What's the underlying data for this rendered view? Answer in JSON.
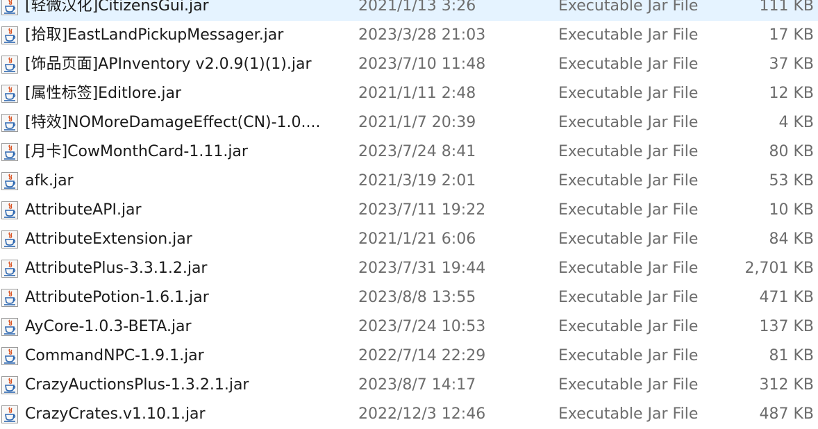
{
  "file_type_icon": "java-jar-icon",
  "files": [
    {
      "name": "[轻微汉化]CitizensGui.jar",
      "date": "2021/1/13 3:26",
      "type": "Executable Jar File",
      "size": "111 KB"
    },
    {
      "name": "[拾取]EastLandPickupMessager.jar",
      "date": "2023/3/28 21:03",
      "type": "Executable Jar File",
      "size": "17 KB"
    },
    {
      "name": "[饰品页面]APInventory v2.0.9(1)(1).jar",
      "date": "2023/7/10 11:48",
      "type": "Executable Jar File",
      "size": "37 KB"
    },
    {
      "name": "[属性标签]Editlore.jar",
      "date": "2021/1/11 2:48",
      "type": "Executable Jar File",
      "size": "12 KB"
    },
    {
      "name": "[特效]NOMoreDamageEffect(CN)-1.0....",
      "date": "2021/1/7 20:39",
      "type": "Executable Jar File",
      "size": "4 KB"
    },
    {
      "name": "[月卡]CowMonthCard-1.11.jar",
      "date": "2023/7/24 8:41",
      "type": "Executable Jar File",
      "size": "80 KB"
    },
    {
      "name": "afk.jar",
      "date": "2021/3/19 2:01",
      "type": "Executable Jar File",
      "size": "53 KB"
    },
    {
      "name": "AttributeAPI.jar",
      "date": "2023/7/11 19:22",
      "type": "Executable Jar File",
      "size": "10 KB"
    },
    {
      "name": "AttributeExtension.jar",
      "date": "2021/1/21 6:06",
      "type": "Executable Jar File",
      "size": "84 KB"
    },
    {
      "name": "AttributePlus-3.3.1.2.jar",
      "date": "2023/7/31 19:44",
      "type": "Executable Jar File",
      "size": "2,701 KB"
    },
    {
      "name": "AttributePotion-1.6.1.jar",
      "date": "2023/8/8 13:55",
      "type": "Executable Jar File",
      "size": "471 KB"
    },
    {
      "name": "AyCore-1.0.3-BETA.jar",
      "date": "2023/7/24 10:53",
      "type": "Executable Jar File",
      "size": "137 KB"
    },
    {
      "name": "CommandNPC-1.9.1.jar",
      "date": "2022/7/14 22:29",
      "type": "Executable Jar File",
      "size": "81 KB"
    },
    {
      "name": "CrazyAuctionsPlus-1.3.2.1.jar",
      "date": "2023/8/7 14:17",
      "type": "Executable Jar File",
      "size": "312 KB"
    },
    {
      "name": "CrazyCrates.v1.10.1.jar",
      "date": "2022/12/3 12:46",
      "type": "Executable Jar File",
      "size": "487 KB"
    }
  ]
}
